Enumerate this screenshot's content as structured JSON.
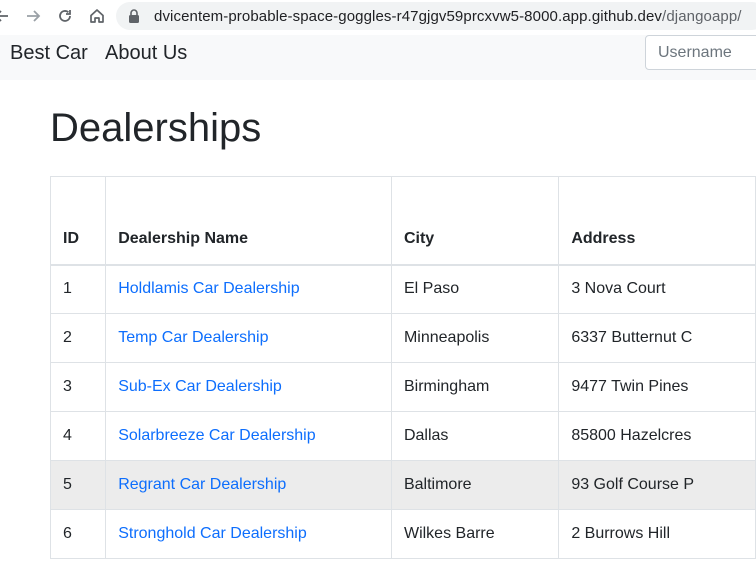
{
  "browser": {
    "url_host": "dvicentem-probable-space-goggles-r47gjgv59prcxvw5-8000.app.github.dev",
    "url_path": "/djangoapp/"
  },
  "navbar": {
    "brand": "Best Car",
    "about": "About Us",
    "username_placeholder": "Username"
  },
  "page": {
    "title": "Dealerships"
  },
  "table": {
    "headers": [
      "ID",
      "Dealership Name",
      "City",
      "Address"
    ],
    "rows": [
      {
        "id": "1",
        "name": "Holdlamis Car Dealership",
        "city": "El Paso",
        "address": "3 Nova Court"
      },
      {
        "id": "2",
        "name": "Temp Car Dealership",
        "city": "Minneapolis",
        "address": "6337 Butternut C"
      },
      {
        "id": "3",
        "name": "Sub-Ex Car Dealership",
        "city": "Birmingham",
        "address": "9477 Twin Pines"
      },
      {
        "id": "4",
        "name": "Solarbreeze Car Dealership",
        "city": "Dallas",
        "address": "85800 Hazelcres"
      },
      {
        "id": "5",
        "name": "Regrant Car Dealership",
        "city": "Baltimore",
        "address": "93 Golf Course P"
      },
      {
        "id": "6",
        "name": "Stronghold Car Dealership",
        "city": "Wilkes Barre",
        "address": "2 Burrows Hill"
      }
    ]
  },
  "colors": {
    "link": "#0d6efd",
    "navbar_bg": "#f8f9fa",
    "hover_row_bg": "#ececec"
  },
  "icons": [
    "back-arrow-icon",
    "forward-arrow-icon",
    "reload-icon",
    "home-icon",
    "lock-icon"
  ]
}
